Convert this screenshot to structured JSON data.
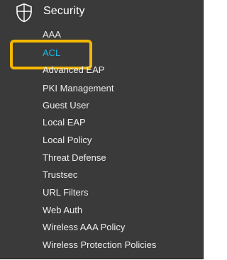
{
  "header": {
    "title": "Security",
    "icon": "shield-icon"
  },
  "menu": {
    "items": [
      {
        "label": "AAA",
        "active": false
      },
      {
        "label": "ACL",
        "active": true
      },
      {
        "label": "Advanced EAP",
        "active": false
      },
      {
        "label": "PKI Management",
        "active": false
      },
      {
        "label": "Guest User",
        "active": false
      },
      {
        "label": "Local EAP",
        "active": false
      },
      {
        "label": "Local Policy",
        "active": false
      },
      {
        "label": "Threat Defense",
        "active": false
      },
      {
        "label": "Trustsec",
        "active": false
      },
      {
        "label": "URL Filters",
        "active": false
      },
      {
        "label": "Web Auth",
        "active": false
      },
      {
        "label": "Wireless AAA Policy",
        "active": false
      },
      {
        "label": "Wireless Protection Policies",
        "active": false
      }
    ]
  },
  "colors": {
    "background": "#3a3a3a",
    "text": "#eeeeee",
    "active": "#1fb7e0",
    "highlight": "#f5b800"
  }
}
